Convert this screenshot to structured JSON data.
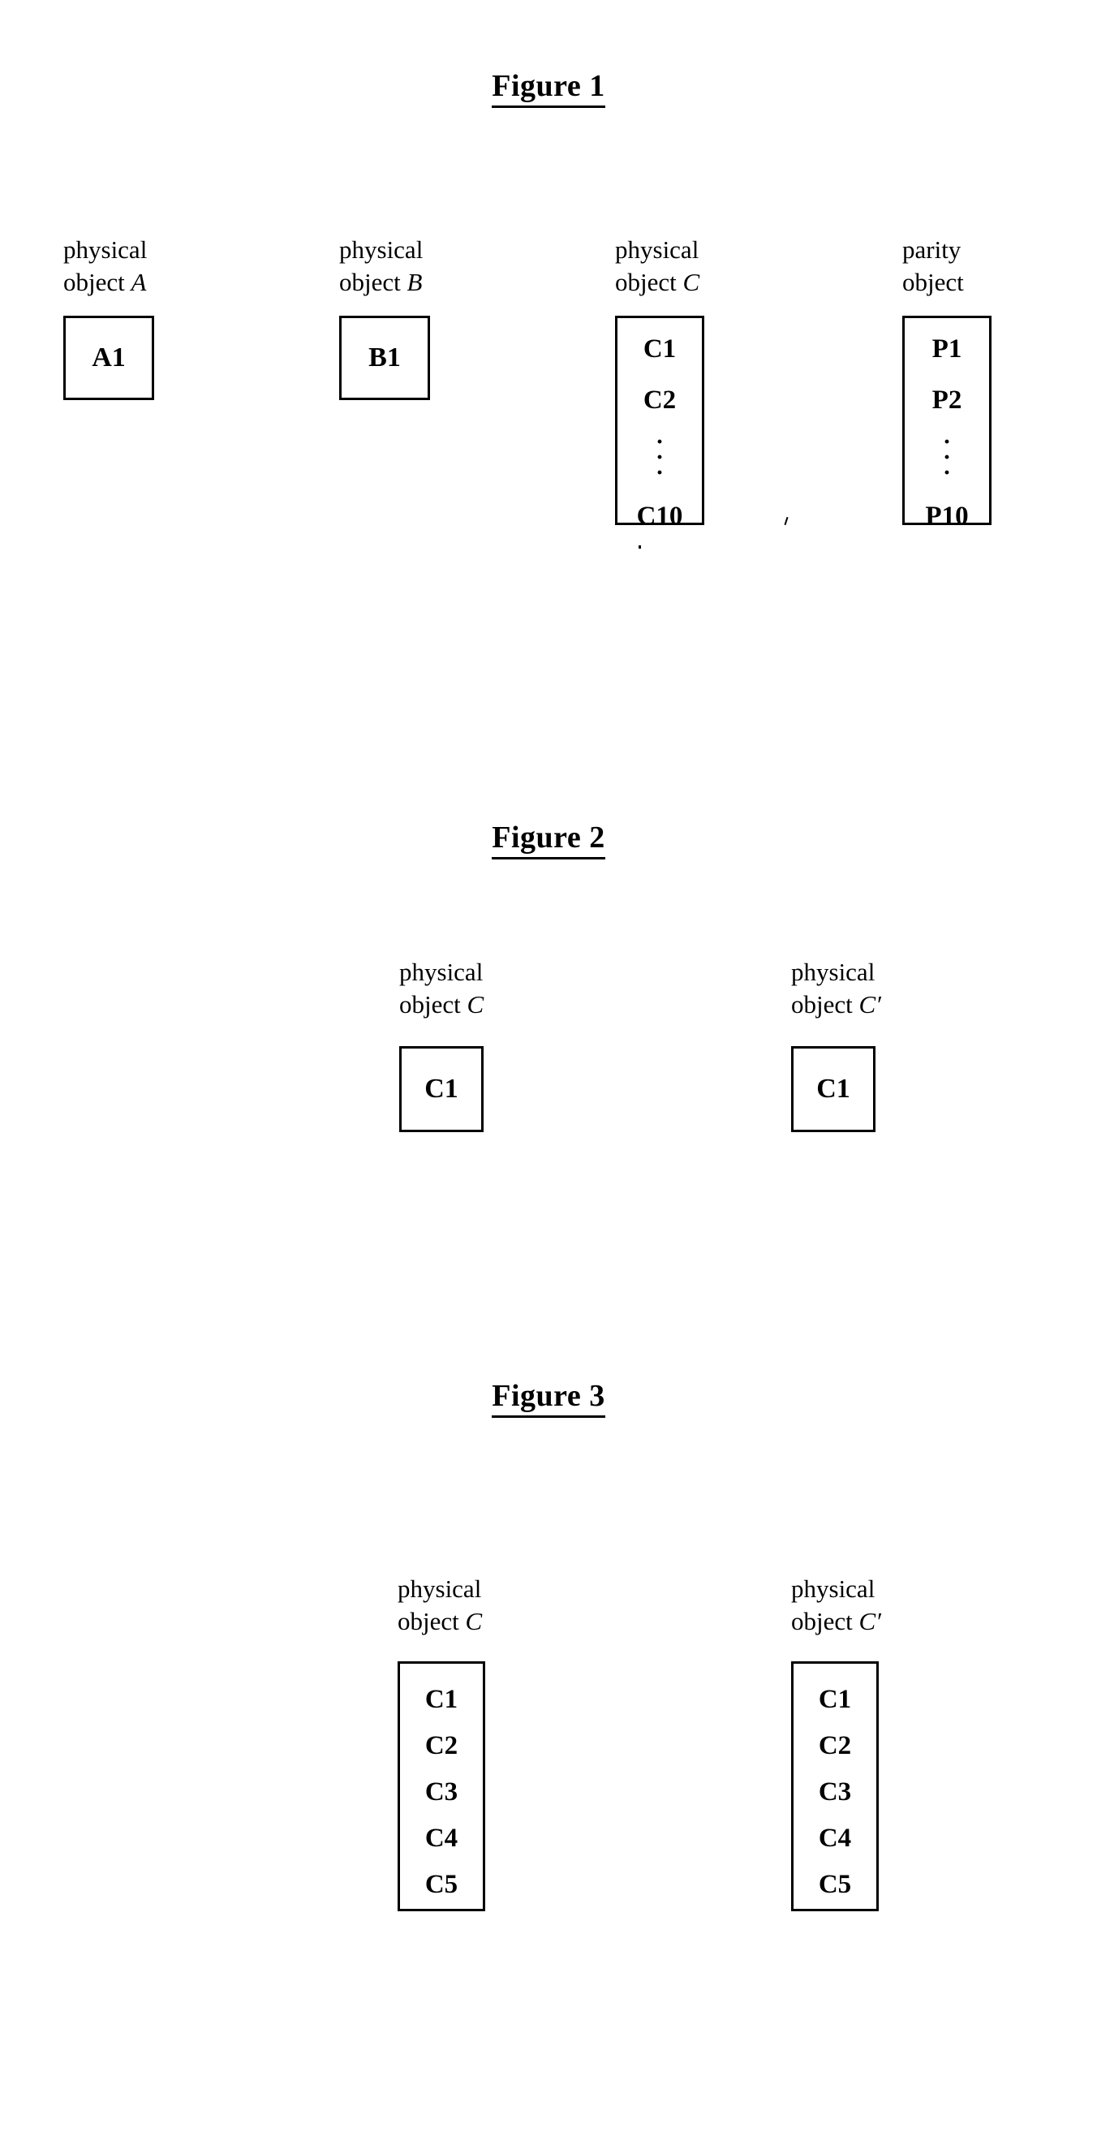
{
  "document": {
    "kind": "patent-figure-sheet",
    "background_color": "#ffffff",
    "line_color": "#000000"
  },
  "figures": [
    {
      "title": "Figure 1",
      "columns": [
        {
          "label_line1": "physical",
          "label_line2_prefix": "object ",
          "label_line2_italic": "A",
          "cells": [
            "A1"
          ],
          "has_ellipsis": false
        },
        {
          "label_line1": "physical",
          "label_line2_prefix": "object ",
          "label_line2_italic": "B",
          "cells": [
            "B1"
          ],
          "has_ellipsis": false
        },
        {
          "label_line1": "physical",
          "label_line2_prefix": "object ",
          "label_line2_italic": "C",
          "cells": [
            "C1",
            "C2",
            "C10"
          ],
          "has_ellipsis": true,
          "ellipsis_after_index": 1
        },
        {
          "label_line1": "parity",
          "label_line2_prefix": "object",
          "label_line2_italic": "",
          "cells": [
            "P1",
            "P2",
            "P10"
          ],
          "has_ellipsis": true,
          "ellipsis_after_index": 1
        }
      ]
    },
    {
      "title": "Figure 2",
      "columns": [
        {
          "label_line1": "physical",
          "label_line2_prefix": "object ",
          "label_line2_italic": "C",
          "cells": [
            "C1"
          ],
          "has_ellipsis": false
        },
        {
          "label_line1": "physical",
          "label_line2_prefix": "object ",
          "label_line2_italic": "C′",
          "cells": [
            "C1"
          ],
          "has_ellipsis": false
        }
      ]
    },
    {
      "title": "Figure 3",
      "columns": [
        {
          "label_line1": "physical",
          "label_line2_prefix": "object  ",
          "label_line2_italic": "C",
          "cells": [
            "C1",
            "C2",
            "C3",
            "C4",
            "C5"
          ],
          "has_ellipsis": false
        },
        {
          "label_line1": "physical",
          "label_line2_prefix": "object  ",
          "label_line2_italic": "C′",
          "cells": [
            "C1",
            "C2",
            "C3",
            "C4",
            "C5"
          ],
          "has_ellipsis": false
        }
      ]
    }
  ],
  "fig1": {
    "title": "Figure 1",
    "colA": {
      "l1": "physical",
      "l2": "object ",
      "it": "A",
      "c1": "A1"
    },
    "colB": {
      "l1": "physical",
      "l2": "object ",
      "it": "B",
      "c1": "B1"
    },
    "colC": {
      "l1": "physical",
      "l2": "object ",
      "it": "C",
      "c1": "C1",
      "c2": "C2",
      "c3": "C10"
    },
    "colP": {
      "l1": "parity",
      "l2": "object",
      "it": "",
      "c1": "P1",
      "c2": "P2",
      "c3": "P10"
    }
  },
  "fig2": {
    "title": "Figure 2",
    "colC": {
      "l1": "physical",
      "l2": "object ",
      "it": "C",
      "c1": "C1"
    },
    "colCp": {
      "l1": "physical",
      "l2": "object ",
      "it": "C′",
      "c1": "C1"
    }
  },
  "fig3": {
    "title": "Figure 3",
    "colC": {
      "l1": "physical",
      "l2": "object  ",
      "it": "C",
      "c1": "C1",
      "c2": "C2",
      "c3": "C3",
      "c4": "C4",
      "c5": "C5"
    },
    "colCp": {
      "l1": "physical",
      "l2": "object  ",
      "it": "C′",
      "c1": "C1",
      "c2": "C2",
      "c3": "C3",
      "c4": "C4",
      "c5": "C5"
    }
  }
}
